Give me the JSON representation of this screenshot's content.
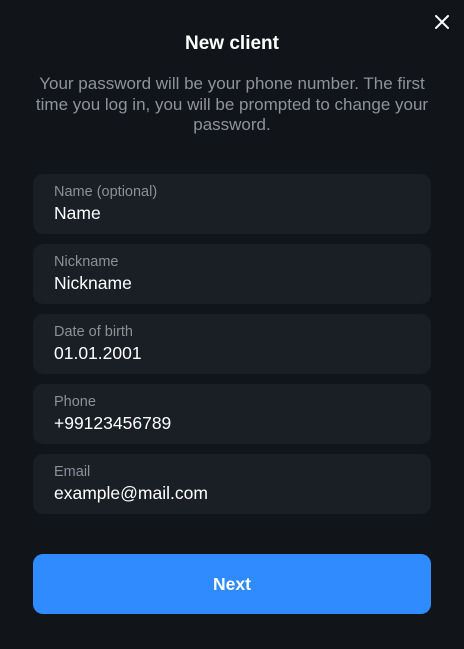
{
  "dialog": {
    "title": "New client",
    "subtitle": "Your password will be your phone number. The first time you log in, you will be prompted to change your password.",
    "close_icon": "close-icon"
  },
  "fields": [
    {
      "label": "Name (optional)",
      "value": "Name"
    },
    {
      "label": "Nickname",
      "value": "Nickname"
    },
    {
      "label": "Date of birth",
      "value": "01.01.2001"
    },
    {
      "label": "Phone",
      "value": "+99123456789"
    },
    {
      "label": "Email",
      "value": "example@mail.com"
    }
  ],
  "actions": {
    "next_label": "Next"
  },
  "colors": {
    "background": "#111419",
    "field_background": "#1a1e25",
    "label": "#8b909a",
    "subtitle": "#8e939c",
    "primary": "#2f8bff"
  }
}
